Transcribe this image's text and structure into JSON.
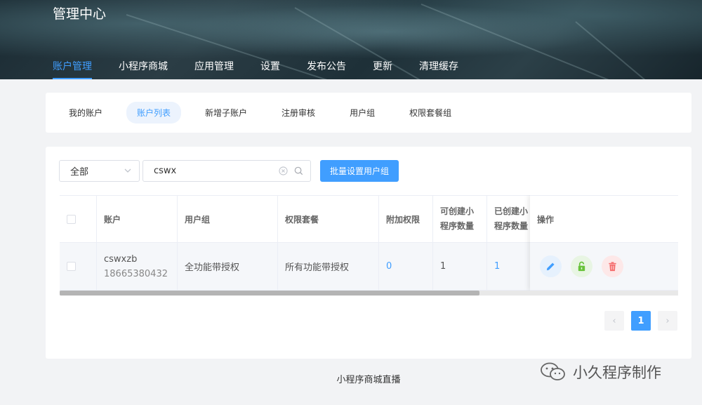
{
  "header": {
    "title": "管理中心",
    "nav": [
      {
        "label": "账户管理",
        "active": true
      },
      {
        "label": "小程序商城",
        "active": false
      },
      {
        "label": "应用管理",
        "active": false
      },
      {
        "label": "设置",
        "active": false
      },
      {
        "label": "发布公告",
        "active": false
      },
      {
        "label": "更新",
        "active": false
      },
      {
        "label": "清理缓存",
        "active": false
      }
    ]
  },
  "subtabs": [
    {
      "label": "我的账户",
      "active": false
    },
    {
      "label": "账户列表",
      "active": true
    },
    {
      "label": "新增子账户",
      "active": false
    },
    {
      "label": "注册审核",
      "active": false
    },
    {
      "label": "用户组",
      "active": false
    },
    {
      "label": "权限套餐组",
      "active": false
    }
  ],
  "filter": {
    "select_value": "全部",
    "search_value": "cswx",
    "batch_button": "批量设置用户组"
  },
  "table": {
    "headers": {
      "account": "账户",
      "group": "用户组",
      "package": "权限套餐",
      "extra": "附加权限",
      "can_create_1": "可创建小",
      "can_create_2": "程序数量",
      "created_1": "已创建小",
      "created_2": "程序数量",
      "actions": "操作"
    },
    "rows": [
      {
        "account_name": "cswxzb",
        "account_phone": "18665380432",
        "group": "全功能带授权",
        "package": "所有功能带授权",
        "extra": "0",
        "can_create": "1",
        "created": "1"
      }
    ]
  },
  "pagination": {
    "current": "1",
    "prev": "‹",
    "next": "›"
  },
  "footer": {
    "text": "小程序商城直播"
  },
  "watermark": {
    "text": "小久程序制作"
  },
  "colors": {
    "accent": "#409eff",
    "edit": "#409eff",
    "lock": "#67c23a",
    "delete": "#f56c6c"
  }
}
